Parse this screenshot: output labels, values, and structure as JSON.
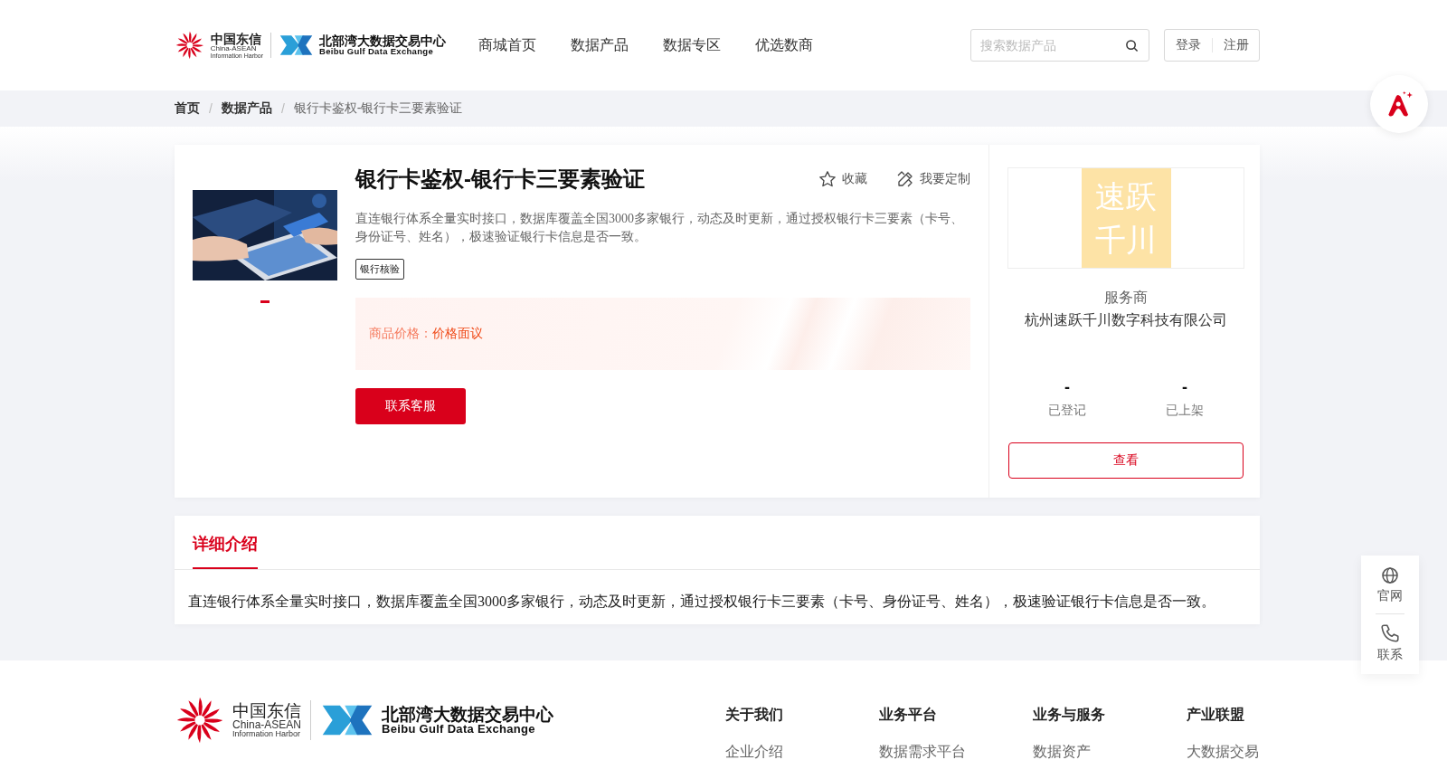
{
  "header": {
    "logo": {
      "brand_cn": "中国东信",
      "brand_en": "China-ASEAN",
      "brand_sub": "Information Harbor",
      "exchange_cn": "北部湾大数据交易中心",
      "exchange_en": "Beibu Gulf Data Exchange"
    },
    "nav": [
      "商城首页",
      "数据产品",
      "数据专区",
      "优选数商"
    ],
    "search": {
      "placeholder": "搜索数据产品"
    },
    "auth": [
      "登录",
      "注册"
    ]
  },
  "breadcrumb": {
    "items": [
      "首页",
      "数据产品",
      "银行卡鉴权-银行卡三要素验证"
    ],
    "separators": [
      "/",
      "/"
    ]
  },
  "product": {
    "carousel": [
      {
        "selected": true
      }
    ],
    "title": "银行卡鉴权-银行卡三要素验证",
    "actions": [
      {
        "kind": "favorite",
        "label": "收藏"
      },
      {
        "kind": "customize",
        "label": "我要定制"
      }
    ],
    "description": "直连银行体系全量实时接口，数据库覆盖全国3000多家银行，动态及时更新，通过授权银行卡三要素（卡号、身份证号、姓名），极速验证银行卡信息是否一致。",
    "tags": [
      "银行核验"
    ],
    "price_label": "商品价格：",
    "price_value": "价格面议",
    "contact_button": "联系客服"
  },
  "provider": {
    "logo_lines": [
      "速跃",
      "千川"
    ],
    "role": "服务商",
    "name": "杭州速跃千川数字科技有限公司",
    "stats": [
      {
        "value": "-",
        "label": "已登记"
      },
      {
        "value": "-",
        "label": "已上架"
      }
    ],
    "view_button": "查看"
  },
  "detail": {
    "tabs": [
      {
        "label": "详细介绍",
        "selected": true
      }
    ],
    "text": "直连银行体系全量实时接口，数据库覆盖全国3000多家银行，动态及时更新，通过授权银行卡三要素（卡号、身份证号、姓名），极速验证银行卡信息是否一致。"
  },
  "side_tools": [
    {
      "kind": "globe",
      "label": "官网"
    },
    {
      "kind": "phone",
      "label": "联系"
    }
  ],
  "footer": {
    "logo": {
      "brand_cn": "中国东信",
      "brand_en": "China-ASEAN",
      "brand_sub": "Information Harbor",
      "exchange_cn": "北部湾大数据交易中心",
      "exchange_en": "Beibu Gulf Data Exchange"
    },
    "columns": [
      {
        "title": "关于我们",
        "links": [
          "企业介绍"
        ]
      },
      {
        "title": "业务平台",
        "links": [
          "数据需求平台"
        ]
      },
      {
        "title": "业务与服务",
        "links": [
          "数据资产"
        ]
      },
      {
        "title": "产业联盟",
        "links": [
          "大数据交易"
        ]
      }
    ]
  }
}
